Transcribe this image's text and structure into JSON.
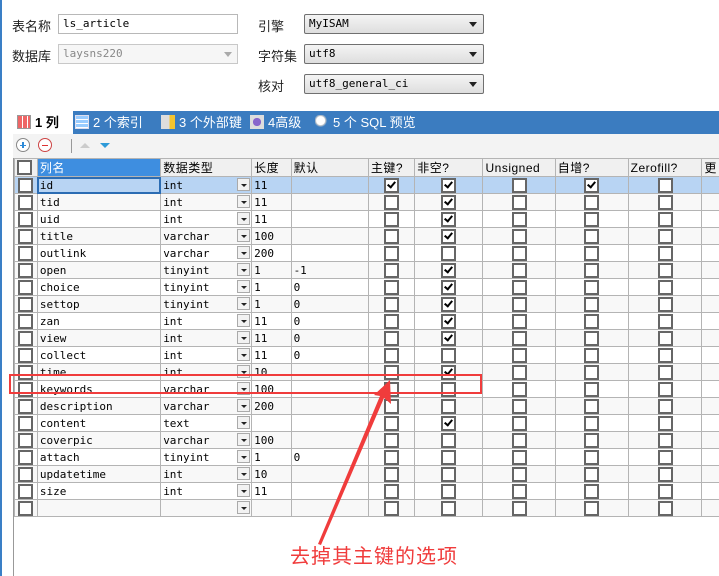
{
  "form": {
    "table_name_label": "表名称",
    "table_name_value": "ls_article",
    "database_label": "数据库",
    "database_value": "laysns220",
    "engine_label": "引擎",
    "engine_value": "MyISAM",
    "charset_label": "字符集",
    "charset_value": "utf8",
    "collation_label": "核对",
    "collation_value": "utf8_general_ci"
  },
  "tabs": [
    {
      "label": "1 列",
      "icon": "columns-grid-icon",
      "active": true
    },
    {
      "label": "2 个索引",
      "icon": "index-icon",
      "active": false
    },
    {
      "label": "3 个外部键",
      "icon": "foreign-key-icon",
      "active": false
    },
    {
      "label": "4高级",
      "icon": "advanced-gear-icon",
      "active": false
    },
    {
      "label": "5 个 SQL 预览",
      "icon": "magnifier-icon",
      "active": false
    }
  ],
  "toolbar": {
    "add": "add-field-icon",
    "remove": "remove-field-icon",
    "move_up": "move-up-icon",
    "move_down": "move-down-icon"
  },
  "grid": {
    "headers": [
      "列名",
      "数据类型",
      "长度",
      "默认",
      "主键?",
      "非空?",
      "Unsigned",
      "自增?",
      "Zerofill?",
      "更"
    ],
    "rows": [
      {
        "name": "id",
        "type": "int",
        "length": "11",
        "default": "",
        "pk": true,
        "notnull": true,
        "unsigned": false,
        "ai": true,
        "zerofill": false
      },
      {
        "name": "tid",
        "type": "int",
        "length": "11",
        "default": "",
        "pk": false,
        "notnull": true,
        "unsigned": false,
        "ai": false,
        "zerofill": false
      },
      {
        "name": "uid",
        "type": "int",
        "length": "11",
        "default": "",
        "pk": false,
        "notnull": true,
        "unsigned": false,
        "ai": false,
        "zerofill": false
      },
      {
        "name": "title",
        "type": "varchar",
        "length": "100",
        "default": "",
        "pk": false,
        "notnull": true,
        "unsigned": false,
        "ai": false,
        "zerofill": false
      },
      {
        "name": "outlink",
        "type": "varchar",
        "length": "200",
        "default": "",
        "pk": false,
        "notnull": false,
        "unsigned": false,
        "ai": false,
        "zerofill": false
      },
      {
        "name": "open",
        "type": "tinyint",
        "length": "1",
        "default": "-1",
        "pk": false,
        "notnull": true,
        "unsigned": false,
        "ai": false,
        "zerofill": false
      },
      {
        "name": "choice",
        "type": "tinyint",
        "length": "1",
        "default": "0",
        "pk": false,
        "notnull": true,
        "unsigned": false,
        "ai": false,
        "zerofill": false
      },
      {
        "name": "settop",
        "type": "tinyint",
        "length": "1",
        "default": "0",
        "pk": false,
        "notnull": true,
        "unsigned": false,
        "ai": false,
        "zerofill": false
      },
      {
        "name": "zan",
        "type": "int",
        "length": "11",
        "default": "0",
        "pk": false,
        "notnull": true,
        "unsigned": false,
        "ai": false,
        "zerofill": false
      },
      {
        "name": "view",
        "type": "int",
        "length": "11",
        "default": "0",
        "pk": false,
        "notnull": true,
        "unsigned": false,
        "ai": false,
        "zerofill": false
      },
      {
        "name": "collect",
        "type": "int",
        "length": "11",
        "default": "0",
        "pk": false,
        "notnull": false,
        "unsigned": false,
        "ai": false,
        "zerofill": false
      },
      {
        "name": "time",
        "type": "int",
        "length": "10",
        "default": "",
        "pk": false,
        "notnull": true,
        "unsigned": false,
        "ai": false,
        "zerofill": false
      },
      {
        "name": "keywords",
        "type": "varchar",
        "length": "100",
        "default": "",
        "pk": false,
        "notnull": false,
        "unsigned": false,
        "ai": false,
        "zerofill": false
      },
      {
        "name": "description",
        "type": "varchar",
        "length": "200",
        "default": "",
        "pk": false,
        "notnull": false,
        "unsigned": false,
        "ai": false,
        "zerofill": false
      },
      {
        "name": "content",
        "type": "text",
        "length": "",
        "default": "",
        "pk": false,
        "notnull": true,
        "unsigned": false,
        "ai": false,
        "zerofill": false
      },
      {
        "name": "coverpic",
        "type": "varchar",
        "length": "100",
        "default": "",
        "pk": false,
        "notnull": false,
        "unsigned": false,
        "ai": false,
        "zerofill": false
      },
      {
        "name": "attach",
        "type": "tinyint",
        "length": "1",
        "default": "0",
        "pk": false,
        "notnull": false,
        "unsigned": false,
        "ai": false,
        "zerofill": false
      },
      {
        "name": "updatetime",
        "type": "int",
        "length": "10",
        "default": "",
        "pk": false,
        "notnull": false,
        "unsigned": false,
        "ai": false,
        "zerofill": false
      },
      {
        "name": "size",
        "type": "int",
        "length": "11",
        "default": "",
        "pk": false,
        "notnull": false,
        "unsigned": false,
        "ai": false,
        "zerofill": false
      },
      {
        "name": "",
        "type": "",
        "length": "",
        "default": "",
        "pk": false,
        "notnull": false,
        "unsigned": false,
        "ai": false,
        "zerofill": false
      }
    ],
    "selected_row": 0
  },
  "annotation": {
    "text": "去掉其主键的选项",
    "color": "#f03c3c",
    "highlighted_row": "time"
  }
}
